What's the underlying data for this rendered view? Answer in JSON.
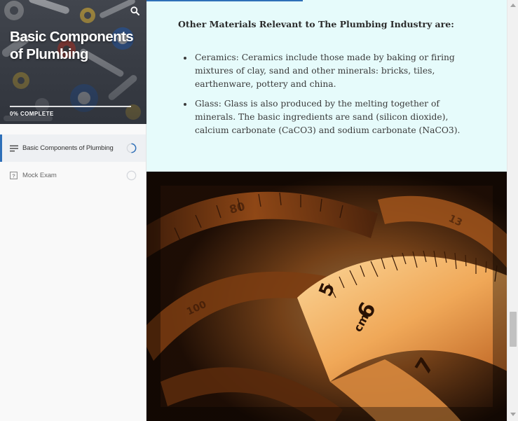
{
  "sidebar": {
    "course_title": "Basic Components of Plumbing",
    "progress_percent": 0,
    "progress_label": "0% COMPLETE",
    "search_icon": "search-icon",
    "lessons": [
      {
        "label": "Basic Components of Plumbing",
        "icon": "text-lines-icon",
        "status": "in-progress-icon",
        "active": true
      },
      {
        "label": "Mock Exam",
        "icon": "question-box-icon",
        "status": "empty-circle-icon",
        "active": false
      }
    ]
  },
  "main": {
    "heading": "Other Materials Relevant to The Plumbing Industry are:",
    "bullets": [
      "Ceramics: Ceramics include those made by baking or firing mixtures of clay, sand and other minerals: bricks, tiles, earthenware, pottery and china.",
      "Glass: Glass is also produced by the melting together of minerals. The basic ingredients are sand (silicon dioxide), calcium carbonate (CaCO3) and sodium carbonate (NaCO3)."
    ],
    "image_icon": "measuring-tape-image"
  },
  "colors": {
    "accent": "#2e6fb8",
    "content_bg": "#e6fbfb",
    "sidebar_bg": "#f9f9f9"
  }
}
